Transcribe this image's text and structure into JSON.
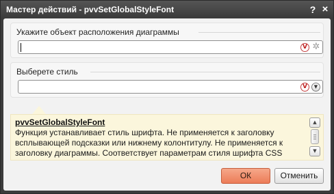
{
  "window": {
    "title": "Мастер действий - pvvSetGlobalStyleFont",
    "help_icon": "?",
    "close_icon": "×"
  },
  "fields": {
    "target": {
      "label": "Укажите объект расположения диаграммы",
      "value": "",
      "icons": [
        "variable-v-icon",
        "gear-icon"
      ]
    },
    "style": {
      "label": "Выберете стиль",
      "value": "",
      "icons": [
        "variable-v-icon",
        "dropdown-arrow-icon"
      ]
    }
  },
  "help": {
    "title": "pvvSetGlobalStyleFont",
    "text": "Функция устанавливает стиль шрифта. Не применяется к заголовку всплывающей подсказки или нижнему колонтитулу. Не применяется к заголовку диаграммы. Соответствует параметрам стиля шрифта CSS"
  },
  "buttons": {
    "ok_label": "ОК",
    "cancel_label": "Отменить"
  },
  "colors": {
    "titlebar": "#3b3b3b",
    "accent_ok": "#ec7c58",
    "help_background": "#fbf6dc"
  }
}
